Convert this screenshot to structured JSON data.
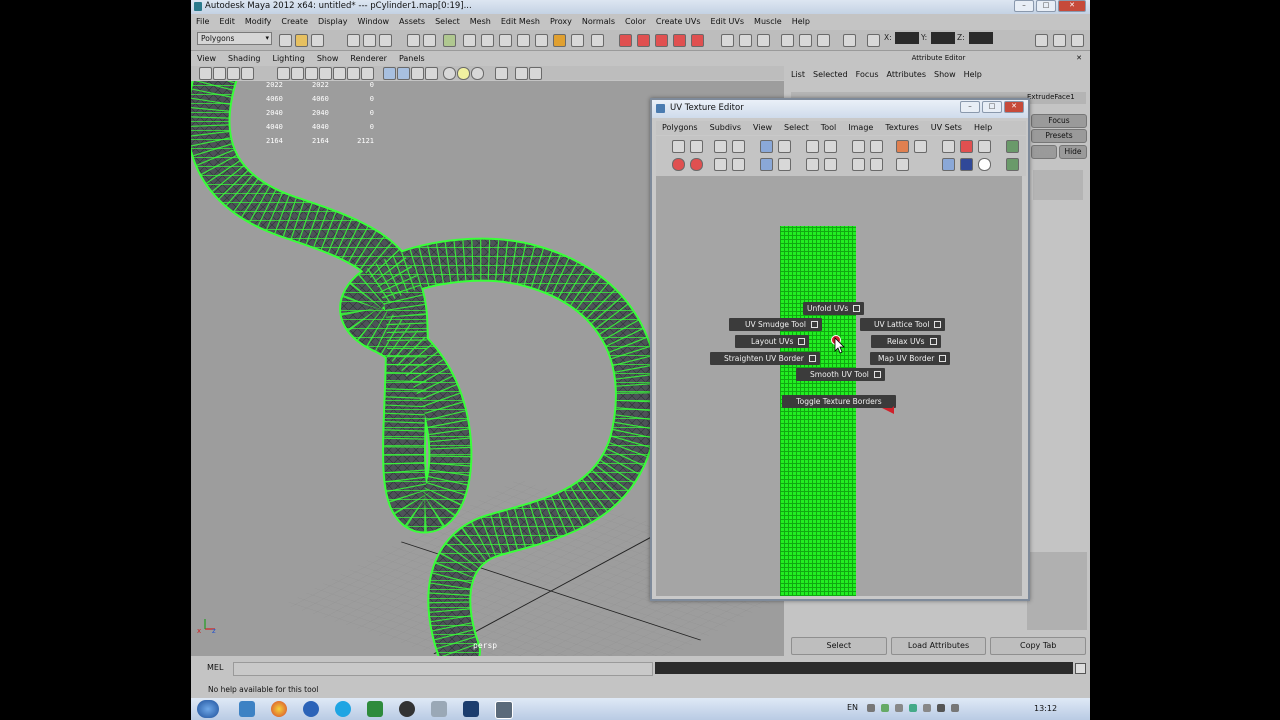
{
  "window": {
    "title": "Autodesk Maya 2012 x64: untitled*   ---   pCylinder1.map[0:19]..."
  },
  "main_menu": [
    "File",
    "Edit",
    "Modify",
    "Create",
    "Display",
    "Window",
    "Assets",
    "Select",
    "Mesh",
    "Edit Mesh",
    "Proxy",
    "Normals",
    "Color",
    "Create UVs",
    "Edit UVs",
    "Muscle",
    "Help"
  ],
  "toolbar": {
    "mode": "Polygons",
    "coord_x": "X:",
    "coord_y": "Y:",
    "coord_z": "Z:"
  },
  "viewport_menu": [
    "View",
    "Shading",
    "Lighting",
    "Show",
    "Renderer",
    "Panels"
  ],
  "hud": {
    "rows": [
      {
        "a": "2022",
        "b": "2022",
        "c": "0"
      },
      {
        "a": "4060",
        "b": "4060",
        "c": "0"
      },
      {
        "a": "2040",
        "b": "2040",
        "c": "0"
      },
      {
        "a": "4040",
        "b": "4040",
        "c": "0"
      },
      {
        "a": "2164",
        "b": "2164",
        "c": "2121"
      }
    ],
    "camera_label": "persp"
  },
  "attribute_editor": {
    "title": "Attribute Editor",
    "menu": [
      "List",
      "Selected",
      "Focus",
      "Attributes",
      "Show",
      "Help"
    ],
    "tab_right": "ExtrudeFace1",
    "focus_btn": "Focus",
    "presets_btn": "Presets",
    "show_btn": "Show",
    "hide_btn": "Hide",
    "bottom_buttons": [
      "Select",
      "Load Attributes",
      "Copy Tab"
    ]
  },
  "uv_editor": {
    "title": "UV Texture Editor",
    "menu": [
      "Polygons",
      "Subdivs",
      "View",
      "Select",
      "Tool",
      "Image",
      "Textures",
      "UV Sets",
      "Help"
    ],
    "marking_menu": {
      "north": "Unfold UVs",
      "northwest": "UV Smudge Tool",
      "northeast": "UV Lattice Tool",
      "west": "Layout UVs",
      "east": "Relax UVs",
      "southwest": "Straighten UV Border",
      "southeast": "Map UV Border",
      "south": "Smooth UV Tool",
      "extra": "Toggle Texture Borders"
    }
  },
  "command_line": {
    "label": "MEL"
  },
  "help_line": {
    "text": "No help available for this tool"
  },
  "taskbar": {
    "language": "EN",
    "clock": "13:12"
  },
  "colors": {
    "wire": "#39ff39",
    "uv_shell": "#22ee22",
    "accent_red": "#d0202a"
  }
}
